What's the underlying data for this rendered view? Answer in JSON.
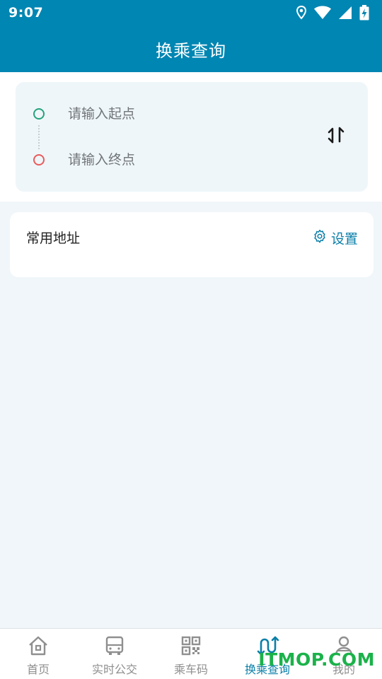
{
  "status_bar": {
    "time": "9:07",
    "icons": [
      "location-icon",
      "wifi-icon",
      "signal-icon",
      "battery-charging-icon"
    ]
  },
  "app_bar": {
    "title": "换乘查询"
  },
  "route": {
    "start_placeholder": "请输入起点",
    "end_placeholder": "请输入终点",
    "start_dot_color": "#25a27b",
    "end_dot_color": "#e85b5b",
    "swap_icon": "swap-vertical-icon"
  },
  "addresses": {
    "title": "常用地址",
    "settings_label": "设置",
    "settings_icon": "gear-icon"
  },
  "tabs": [
    {
      "label": "首页",
      "icon": "home-icon",
      "active": false
    },
    {
      "label": "实时公交",
      "icon": "bus-icon",
      "active": false
    },
    {
      "label": "乘车码",
      "icon": "qr-code-icon",
      "active": false
    },
    {
      "label": "换乘查询",
      "icon": "transfer-route-icon",
      "active": true
    },
    {
      "label": "我的",
      "icon": "user-icon",
      "active": false
    }
  ],
  "watermark": "ITMOP.COM",
  "colors": {
    "primary": "#0086b3",
    "accent": "#0a7fa8",
    "background": "#f0f6f9",
    "watermark": "#1bb24a"
  }
}
